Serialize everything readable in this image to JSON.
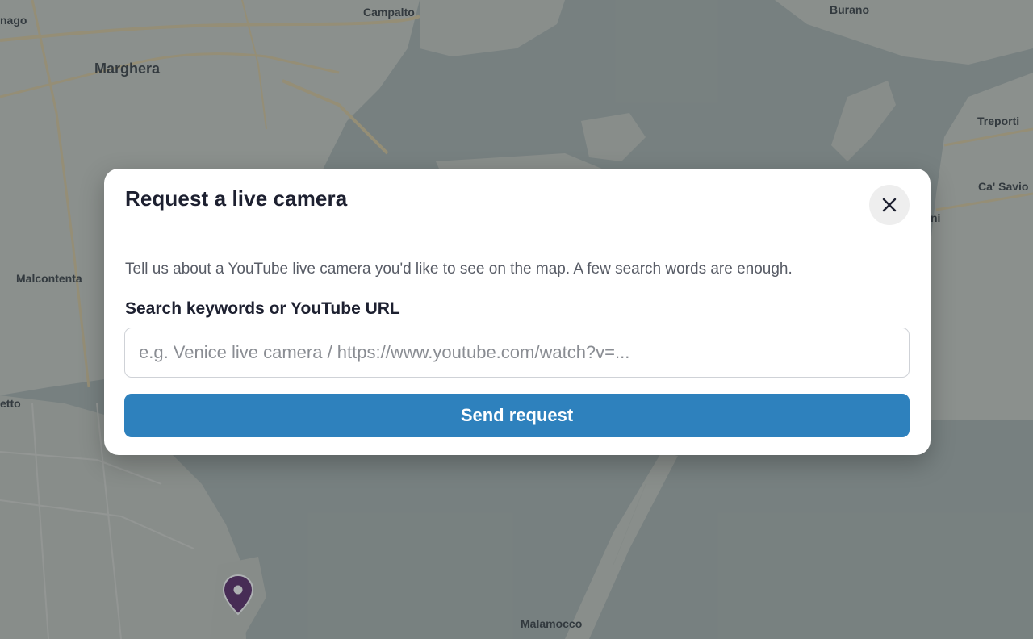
{
  "map": {
    "labels": {
      "mago": "nago",
      "campalto": "Campalto",
      "burano": "Burano",
      "marghera": "Marghera",
      "treporti": "Treporti",
      "ca_savio": "Ca' Savio",
      "malcontenta": "Malcontenta",
      "ni": "ni",
      "etto": "etto",
      "malamocco": "Malamocco"
    },
    "marker_icon": "map-pin-icon",
    "colors": {
      "land": "#c5c9c2",
      "water": "#a7b0ad",
      "roads": "#d9c79a",
      "marker": "#5b2a6a"
    }
  },
  "modal": {
    "title": "Request a live camera",
    "close_icon": "close-icon",
    "description": "Tell us about a YouTube live camera you'd like to see on the map. A few search words are enough.",
    "field_label": "Search keywords or YouTube URL",
    "input_value": "",
    "input_placeholder": "e.g. Venice live camera / https://www.youtube.com/watch?v=...",
    "submit_label": "Send request",
    "accent_color": "#2e81bd"
  }
}
